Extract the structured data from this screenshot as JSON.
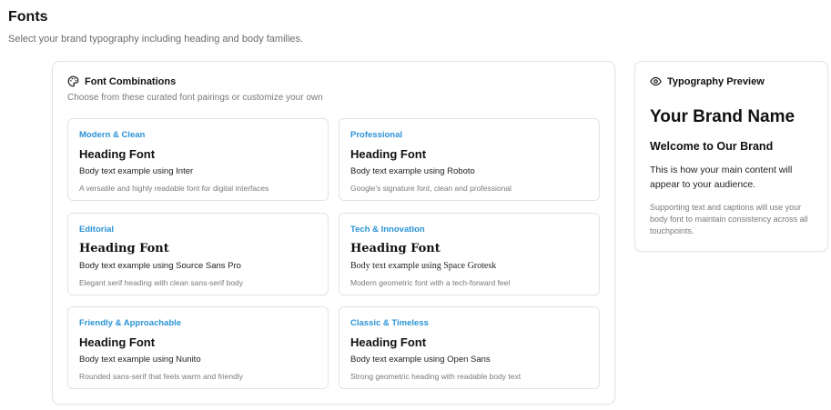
{
  "page": {
    "title": "Fonts",
    "subtitle": "Select your brand typography including heading and body families."
  },
  "combinations": {
    "title": "Font Combinations",
    "icon": "palette-icon",
    "description": "Choose from these curated font pairings or customize your own",
    "cards": [
      {
        "category": "Modern & Clean",
        "heading": "Heading Font",
        "body": "Body text example using Inter",
        "note": "A versatile and highly readable font for digital interfaces"
      },
      {
        "category": "Professional",
        "heading": "Heading Font",
        "body": "Body text example using Roboto",
        "note": "Google's signature font, clean and professional"
      },
      {
        "category": "Editorial",
        "heading": "Heading Font",
        "body": "Body text example using Source Sans Pro",
        "note": "Elegant serif heading with clean sans-serif body"
      },
      {
        "category": "Tech & Innovation",
        "heading": "Heading Font",
        "body": "Body text example using Space Grotesk",
        "note": "Modern geometric font with a tech-forward feel"
      },
      {
        "category": "Friendly & Approachable",
        "heading": "Heading Font",
        "body": "Body text example using Nunito",
        "note": "Rounded sans-serif that feels warm and friendly"
      },
      {
        "category": "Classic & Timeless",
        "heading": "Heading Font",
        "body": "Body text example using Open Sans",
        "note": "Strong geometric heading with readable body text"
      }
    ]
  },
  "preview": {
    "title": "Typography Preview",
    "icon": "eye-icon",
    "brand_name": "Your Brand Name",
    "welcome": "Welcome to Our Brand",
    "main_text": "This is how your main content will appear to your audience.",
    "supporting_text": "Supporting text and captions will use your body font to maintain consistency across all touchpoints."
  },
  "colors": {
    "accent": "#2a93d5",
    "border": "#e3e3e3",
    "muted_text": "#7a7a7a"
  }
}
